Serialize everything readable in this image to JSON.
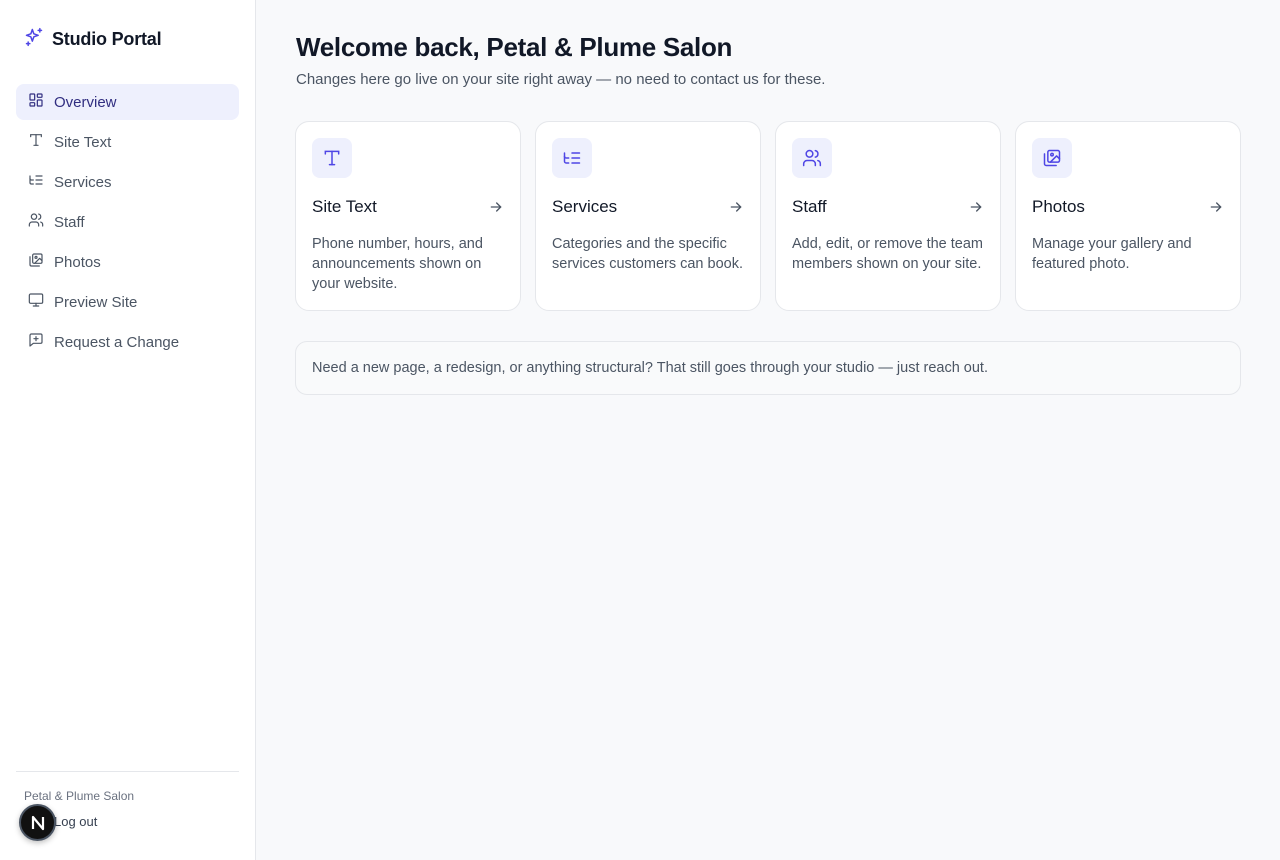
{
  "brand": {
    "title": "Studio Portal",
    "icon": "sparkles-icon",
    "accent": "#4f46e5"
  },
  "sidebar": {
    "items": [
      {
        "label": "Overview",
        "icon": "dashboard-icon",
        "active": true
      },
      {
        "label": "Site Text",
        "icon": "type-icon"
      },
      {
        "label": "Services",
        "icon": "list-tree-icon"
      },
      {
        "label": "Staff",
        "icon": "users-icon"
      },
      {
        "label": "Photos",
        "icon": "images-icon"
      },
      {
        "label": "Preview Site",
        "icon": "monitor-icon"
      },
      {
        "label": "Request a Change",
        "icon": "message-plus-icon"
      }
    ],
    "footer": {
      "business_name": "Petal & Plume Salon",
      "logout_label": "Log out"
    }
  },
  "avatar": {
    "initial": "N"
  },
  "main": {
    "title": "Welcome back, Petal & Plume Salon",
    "subtitle": "Changes here go live on your site right away — no need to contact us for these.",
    "cards": [
      {
        "title": "Site Text",
        "icon": "type-icon",
        "description": "Phone number, hours, and announcements shown on your website."
      },
      {
        "title": "Services",
        "icon": "list-tree-icon",
        "description": "Categories and the specific services customers can book."
      },
      {
        "title": "Staff",
        "icon": "users-icon",
        "description": "Add, edit, or remove the team members shown on your site."
      },
      {
        "title": "Photos",
        "icon": "images-icon",
        "description": "Manage your gallery and featured photo."
      }
    ],
    "notice": "Need a new page, a redesign, or anything structural? That still goes through your studio — just reach out."
  },
  "colors": {
    "accent": "#4f46e5",
    "active_bg": "#eef0fd",
    "background": "#f8f9fb"
  }
}
